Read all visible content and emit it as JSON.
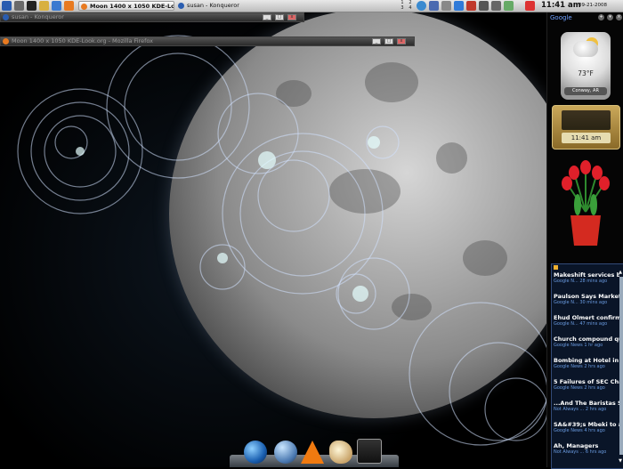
{
  "taskbar": {
    "tasks": [
      {
        "label": "Moon 1400 x 1050 KDE-Lo...",
        "active": true
      },
      {
        "label": "susan - Konqueror",
        "active": false
      }
    ],
    "pager": [
      "1",
      "2",
      "3",
      "4"
    ],
    "clock": "11:41 am",
    "date": "09-21-2008"
  },
  "windows": [
    {
      "title": "susan - Konqueror"
    },
    {
      "title": "Moon 1400 x 1050 KDE-Look.org - Mozilla Firefox"
    }
  ],
  "sidebar": {
    "logo": "Google",
    "weather": {
      "temp": "73°F",
      "location": "Conway, AR"
    },
    "clock": "11:41 am",
    "news": [
      {
        "title": "Makeshift services bring comfort to T...",
        "source": "Google N... 28 mins ago"
      },
      {
        "title": "Paulson Says Markets Fragile, ...",
        "source": "Google N... 30 mins ago"
      },
      {
        "title": "Ehud Olmert confirms resignat...",
        "source": "Google N... 47 mins ago"
      },
      {
        "title": "Church compound quiet after child ...",
        "source": "Google News     1 hr ago"
      },
      {
        "title": "Bombing at Hotel in Pakistan Kills a...",
        "source": "Google News    2 hrs ago"
      },
      {
        "title": "5 Failures of SEC Chairman Cox - S...",
        "source": "Google News    2 hrs ago"
      },
      {
        "title": "...And The Baristas Shall Inherit The ...",
        "source": "Not Always ...  2 hrs ago"
      },
      {
        "title": "SA&#39;s Mbeki to address the nati...",
        "source": "Google News    4 hrs ago"
      },
      {
        "title": "Ah, Managers",
        "source": "Not Always ...  6 hrs ago"
      }
    ]
  },
  "dock": [
    "globe-icon",
    "sphere-icon",
    "vlc-icon",
    "gimp-icon",
    "terminal-icon"
  ],
  "colors": {
    "accent": "#6a9be0",
    "news_bg": "#0a1528",
    "taskbar": "#d0d0d0"
  }
}
